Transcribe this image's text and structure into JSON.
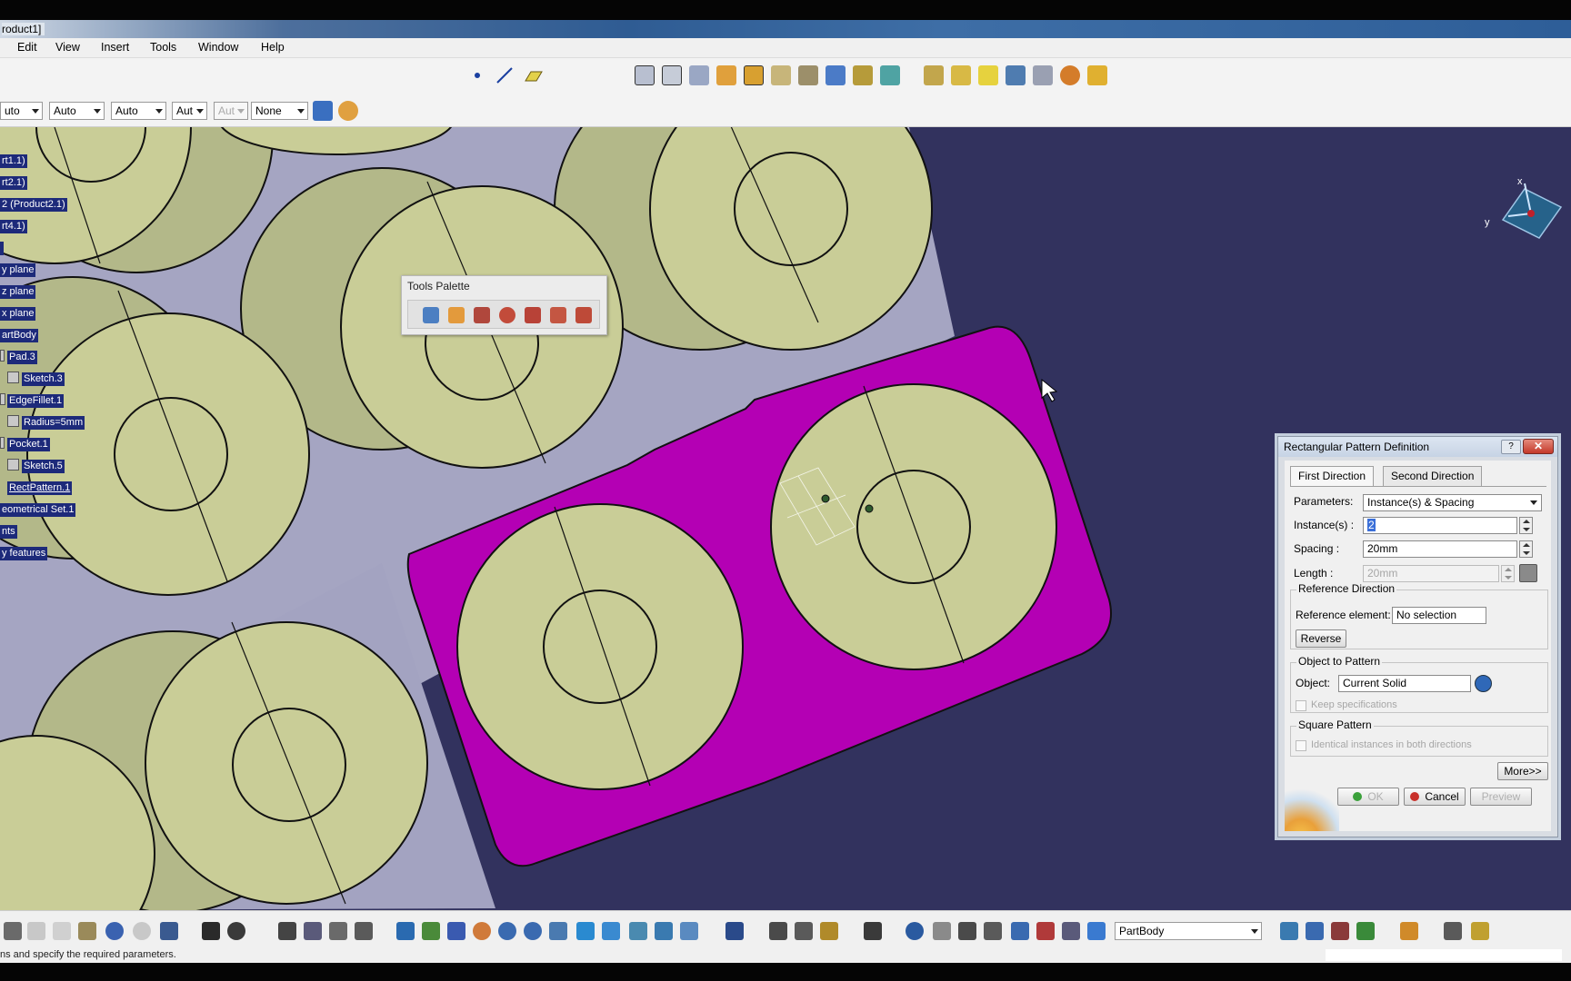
{
  "window": {
    "title": "roduct1]"
  },
  "menu": [
    "Edit",
    "View",
    "Insert",
    "Tools",
    "Window",
    "Help"
  ],
  "toolbar2": {
    "combo1": "uto",
    "combo2": "Auto",
    "combo3": "Auto",
    "combo4": "Aut",
    "combo5": "Aut",
    "combo6": "None"
  },
  "tree": [
    "rt1.1)",
    "rt2.1)",
    "2 (Product2.1)",
    "rt4.1)",
    "",
    "y plane",
    "z plane",
    "x plane",
    "artBody",
    "Pad.3",
    "Sketch.3",
    "EdgeFillet.1",
    "Radius=5mm",
    "Pocket.1",
    "Sketch.5",
    "RectPattern.1",
    "eometrical Set.1",
    "nts",
    "y features"
  ],
  "compass": {
    "x_label": "x",
    "y_label": "y"
  },
  "palette": {
    "title": "Tools Palette"
  },
  "dialog": {
    "title": "Rectangular Pattern Definition",
    "help": "?",
    "close": "✕",
    "tabs": [
      "First Direction",
      "Second Direction"
    ],
    "parameters_label": "Parameters:",
    "parameters_value": "Instance(s) & Spacing",
    "instances_label": "Instance(s) :",
    "instances_value": "2",
    "spacing_label": "Spacing :",
    "spacing_value": "20mm",
    "length_label": "Length :",
    "length_value": "20mm",
    "refdir_title": "Reference Direction",
    "refelem_label": "Reference element:",
    "refelem_value": "No selection",
    "reverse_btn": "Reverse",
    "object_title": "Object to Pattern",
    "object_label": "Object:",
    "object_value": "Current Solid",
    "keep_spec": "Keep specifications",
    "square_title": "Square Pattern",
    "identical": "Identical instances in both directions",
    "more_btn": "More>>",
    "ok_btn": "OK",
    "cancel_btn": "Cancel",
    "preview_btn": "Preview"
  },
  "bottom": {
    "partbody_combo": "PartBody"
  },
  "status": {
    "text": "ns and specify the required parameters."
  }
}
